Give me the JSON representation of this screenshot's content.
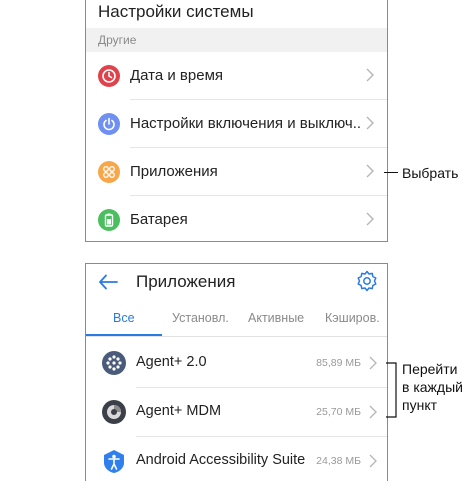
{
  "settings_screen": {
    "title": "Настройки системы",
    "section": "Другие",
    "items": [
      {
        "label": "Дата и время",
        "icon": "clock-icon",
        "color": "#e0424b"
      },
      {
        "label": "Настройки включения и выключ..",
        "icon": "power-icon",
        "color": "#6f8ff2"
      },
      {
        "label": "Приложения",
        "icon": "apps-icon",
        "color": "#f7a74a"
      },
      {
        "label": "Батарея",
        "icon": "battery-icon",
        "color": "#4bbf5e"
      }
    ]
  },
  "apps_screen": {
    "title": "Приложения",
    "tabs": [
      {
        "label": "Все",
        "active": true
      },
      {
        "label": "Установл.",
        "active": false
      },
      {
        "label": "Активные",
        "active": false
      },
      {
        "label": "Кэширов.",
        "active": false
      }
    ],
    "apps": [
      {
        "name": "Agent+ 2.0",
        "size": "85,89 МБ",
        "icon": "agent-icon"
      },
      {
        "name": "Agent+ MDM",
        "size": "25,70 МБ",
        "icon": "agent-mdm-icon"
      },
      {
        "name": "Android Accessibility Suite",
        "size": "24,38 МБ",
        "icon": "accessibility-icon"
      }
    ]
  },
  "annotations": {
    "select": "Выбрать",
    "go_each_line1": "Перейти",
    "go_each_line2": "в каждый",
    "go_each_line3": "пункт"
  },
  "colors": {
    "accent": "#2a7ae2",
    "panel_border": "#8a8a8a",
    "section_band": "#f1f1f1"
  }
}
